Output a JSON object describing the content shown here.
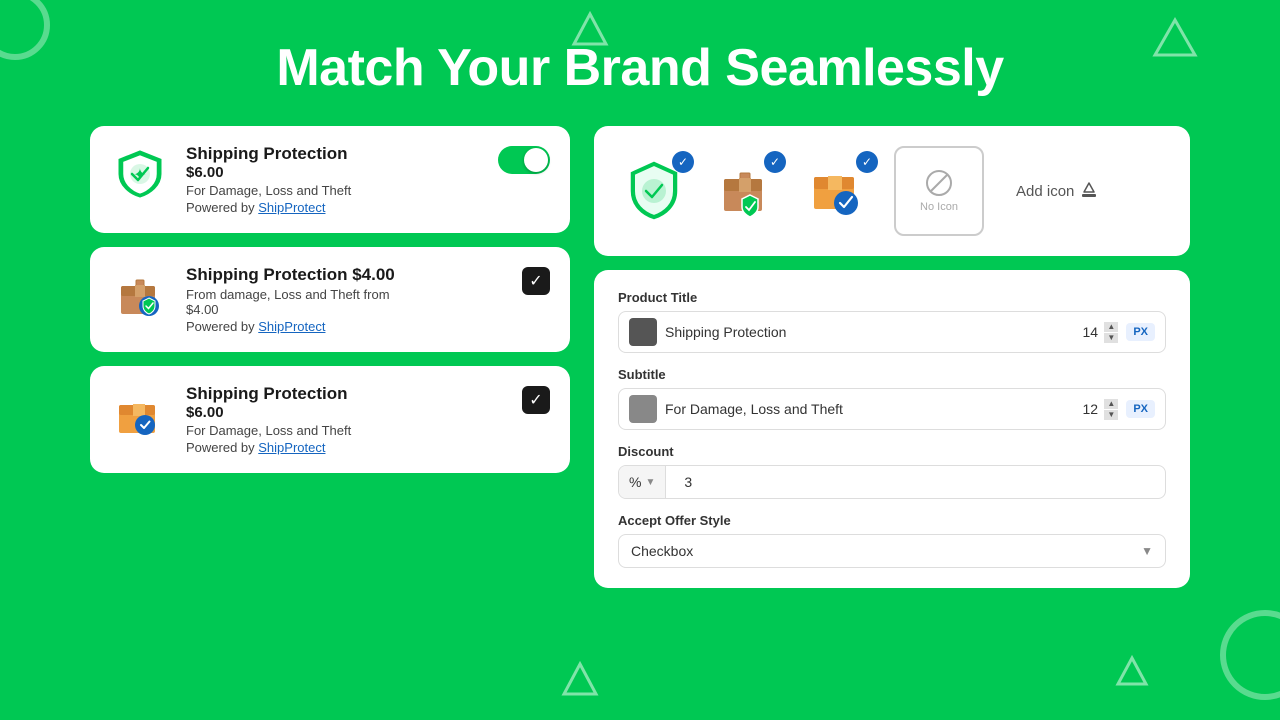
{
  "headline": "Match Your Brand Seamlessly",
  "left_cards": [
    {
      "id": "card1",
      "title": "Shipping Protection",
      "price": "$6.00",
      "subtitle": "For Damage, Loss and Theft",
      "powered_by": "Powered by ",
      "powered_link": "ShipProtect",
      "control_type": "toggle",
      "icon_type": "green_shield"
    },
    {
      "id": "card2",
      "title": "Shipping Protection $4.00",
      "subtitle": "From damage, Loss and Theft from $4.00",
      "powered_by": "Powered by ",
      "powered_link": "ShipProtect",
      "control_type": "checkbox",
      "icon_type": "brown_box"
    },
    {
      "id": "card3",
      "title": "Shipping Protection",
      "price": "$6.00",
      "subtitle": "For Damage, Loss and Theft",
      "powered_by": "Powered by ",
      "powered_link": "ShipProtect",
      "control_type": "checkbox",
      "icon_type": "orange_box"
    }
  ],
  "icons_panel": {
    "icons": [
      {
        "id": "icon1",
        "type": "green_shield",
        "selected": true
      },
      {
        "id": "icon2",
        "type": "brown_box_shield",
        "selected": true
      },
      {
        "id": "icon3",
        "type": "orange_box_check",
        "selected": true
      },
      {
        "id": "icon4",
        "type": "no_icon",
        "label": "No Icon"
      }
    ],
    "add_icon_label": "Add icon"
  },
  "form": {
    "product_title_label": "Product Title",
    "product_title_color": "#555555",
    "product_title_value": "Shipping Protection",
    "product_title_size": "14",
    "product_title_unit": "PX",
    "subtitle_label": "Subtitle",
    "subtitle_color": "#888888",
    "subtitle_value": "For Damage, Loss and Theft",
    "subtitle_size": "12",
    "subtitle_unit": "PX",
    "discount_label": "Discount",
    "discount_prefix": "%",
    "discount_value": "3",
    "accept_offer_label": "Accept Offer Style",
    "accept_offer_value": "Checkbox"
  }
}
